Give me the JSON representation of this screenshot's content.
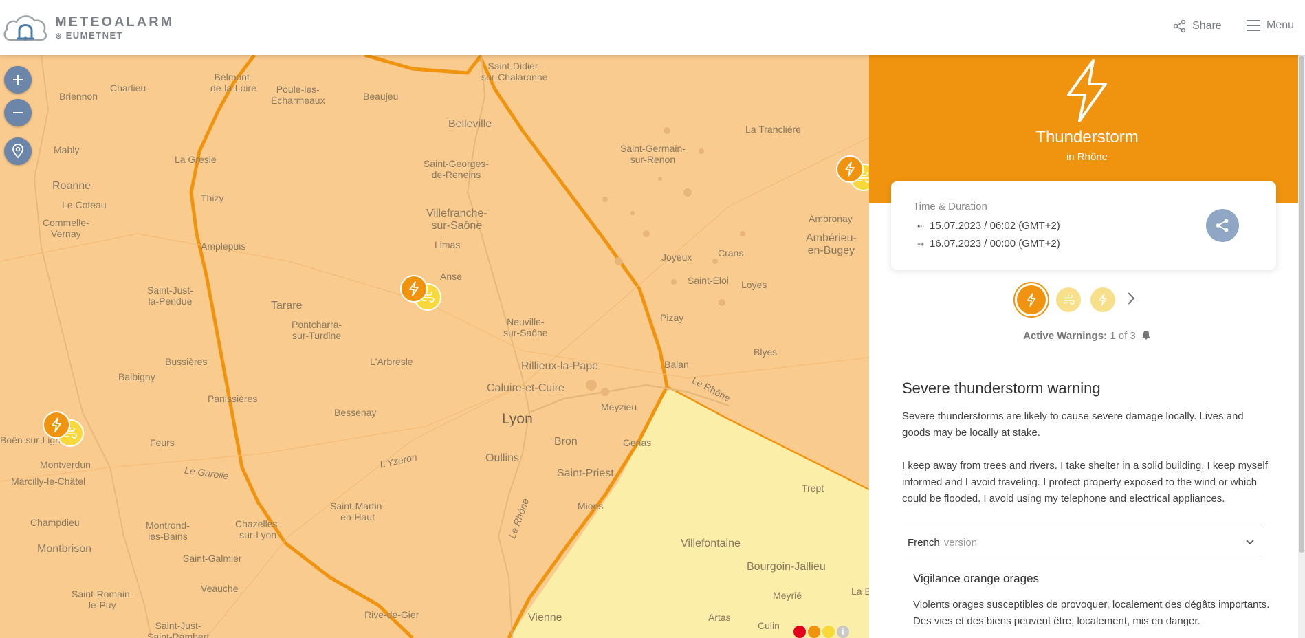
{
  "header": {
    "logo_main": "METEOALARM",
    "logo_sub": "EUMETNET",
    "share_label": "Share",
    "menu_label": "Menu"
  },
  "map": {
    "places": {
      "lyon": "Lyon",
      "rillieux": "Rillieux-la-Pape",
      "caluire": "Caluire-et-Cuire",
      "villefranche_1": "Villefranche-",
      "villefranche_2": "sur-Saône",
      "belleville": "Belleville",
      "beaujeu": "Beaujeu",
      "tarare": "Tarare",
      "roanne": "Roanne",
      "montbrison": "Montbrison",
      "vienne": "Vienne",
      "bron": "Bron",
      "oullins": "Oullins",
      "saint_priest": "Saint-Priest",
      "meyzieu": "Meyzieu",
      "genas": "Genas",
      "villefontaine": "Villefontaine",
      "bourgoin": "Bourgoin-Jallieu",
      "amberieu_1": "Ambérieu-",
      "amberieu_2": "en-Bugey",
      "ambronay": "Ambronay",
      "la_tranclière": "La Tranclière",
      "crans": "Crans",
      "joyeux": "Joyeux",
      "saint_eloi": "Saint-Éloi",
      "loyes": "Loyes",
      "blyes": "Blyes",
      "pizay": "Pizay",
      "balan": "Balan",
      "le_rhone_1": "Le Rhône",
      "le_rhone_2": "Le Rhône",
      "trept": "Trept",
      "meyrie": "Meyrié",
      "artas": "Artas",
      "culin": "Culin",
      "la_b": "La B",
      "rive_de_gier": "Rive-de-Gier",
      "saint_just_1": "Saint-Just-",
      "saint_just_2": "la-Pendue",
      "bussieres": "Bussières",
      "balbigny": "Balbigny",
      "panissieres": "Panissières",
      "feurs": "Feurs",
      "bessenay": "Bessenay",
      "arbresle": "L'Arbresle",
      "pontcharra_1": "Pontcharra-",
      "pontcharra_2": "sur-Turdine",
      "neuville_1": "Neuville-",
      "neuville_2": "sur-Saône",
      "anse": "Anse",
      "limas": "Limas",
      "sgr_1": "Saint-Georges-",
      "sgr_2": "de-Reneins",
      "sgs_1": "Saint-Germain-",
      "sgs_2": "sur-Renon",
      "sdc_1": "Saint-Didier-",
      "sdc_2": "sur-Chalaronne",
      "thizy": "Thizy",
      "amplepuis": "Amplepuis",
      "la_gresle": "La Gresle",
      "mably": "Mably",
      "le_coteau": "Le Coteau",
      "commelle_1": "Commelle-",
      "commelle_2": "Vernay",
      "charlieu": "Charlieu",
      "briennon": "Briennon",
      "belmont_1": "Belmont-",
      "belmont_2": "de-la-Loire",
      "poule_1": "Poule-les-",
      "poule_2": "Écharmeaux",
      "boen": "Boën-sur-Lignon",
      "montverdun": "Montverdun",
      "marcilly": "Marcilly-le-Châtel",
      "champdieu": "Champdieu",
      "montrond_1": "Montrond-",
      "montrond_2": "les-Bains",
      "saint_galmier": "Saint-Galmier",
      "veauche": "Veauche",
      "chazelles_1": "Chazelles-",
      "chazelles_2": "sur-Lyon",
      "smh_1": "Saint-Martin-",
      "smh_2": "en-Haut",
      "sre_1": "Saint-Romain-",
      "sre_2": "le-Puy",
      "sj_1": "Saint-Just-",
      "sj_2": "Saint-Rambert",
      "le_gand": "Le Garolle",
      "yzeron": "L'Yzeron",
      "mions": "Mions",
      "le_rhone_3": "Le Rhône"
    }
  },
  "panel": {
    "title": "Thunderstorm",
    "subtitle": "in Rhône",
    "time_label": "Time & Duration",
    "time_from": "15.07.2023 / 06:02 (GMT+2)",
    "time_to": "16.07.2023 / 00:00 (GMT+2)",
    "active_label": "Active Warnings:",
    "active_count": "1 of 3",
    "warning_title": "Severe thunderstorm warning",
    "warning_desc": "Severe thunderstorms are likely to cause severe damage locally. Lives and goods may be locally at stake.",
    "warning_advice": "I keep away from trees and rivers. I take shelter in a solid building. I keep myself informed and I avoid traveling. I protect property exposed to the wind or which could be flooded. I avoid using my telephone and electrical appliances.",
    "lang_label": "French",
    "lang_version": "version",
    "fr_title": "Vigilance orange orages",
    "fr_desc": "Violents orages susceptibles de provoquer, localement des dégâts importants. Des vies et des biens peuvent être, localement, mis en danger."
  },
  "colors": {
    "orange": "#f0940f",
    "yellow": "#f8d83a",
    "red": "#e3001b",
    "map_orange": "#f9cb8f",
    "map_yellow": "#fbeea8",
    "ctrl_blue": "#6b86a8"
  }
}
